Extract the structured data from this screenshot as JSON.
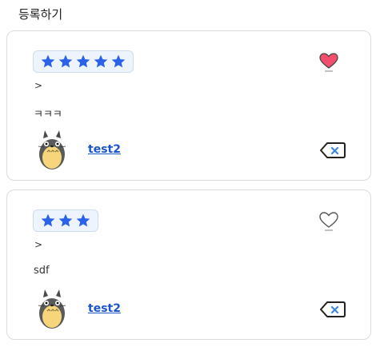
{
  "page": {
    "title": "등록하기"
  },
  "reviews": [
    {
      "rating": 5,
      "separator": ">",
      "content": "ㅋㅋㅋ",
      "liked": true,
      "username": "test2"
    },
    {
      "rating": 3,
      "separator": ">",
      "content": "sdf",
      "liked": false,
      "username": "test2"
    }
  ],
  "colors": {
    "star": "#2b63e8",
    "heart_liked": "#f0506e",
    "heart_outline": "#555555",
    "username": "#1a56c9",
    "card_border": "#dcdcdc",
    "stars_bg": "#eef4fd"
  },
  "icons": {
    "star": "star-icon",
    "heart": "heart-icon",
    "avatar": "totoro-avatar",
    "delete": "backspace-delete-icon"
  }
}
